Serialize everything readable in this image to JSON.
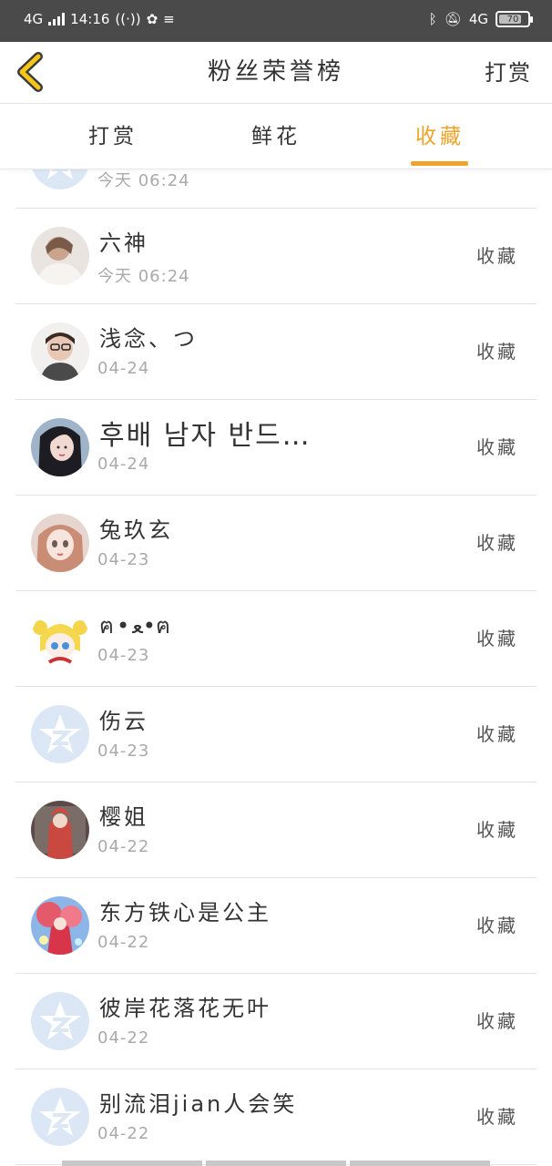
{
  "status_bar": {
    "network_left": "4G",
    "time": "14:16",
    "network_right": "4G",
    "battery": "70"
  },
  "header": {
    "title": "粉丝荣誉榜",
    "action": "打赏"
  },
  "tabs": [
    {
      "label": "打赏",
      "active": false
    },
    {
      "label": "鲜花",
      "active": false
    },
    {
      "label": "收藏",
      "active": true
    }
  ],
  "accent_color": "#f0a32a",
  "list": [
    {
      "name": "",
      "date": "今天 06:24",
      "action": "",
      "avatar": "default-star"
    },
    {
      "name": "六神",
      "date": "今天 06:24",
      "action": "收藏",
      "avatar": "photo-girl-white"
    },
    {
      "name": "浅念、つ",
      "date": "04-24",
      "action": "收藏",
      "avatar": "photo-boy-glasses"
    },
    {
      "name": "후배 남자 반드…",
      "date": "04-24",
      "action": "收藏",
      "avatar": "photo-girl-dark"
    },
    {
      "name": "兔玖玄",
      "date": "04-23",
      "action": "收藏",
      "avatar": "doll-face"
    },
    {
      "name": "ฅ•ﻌ•ฅ",
      "date": "04-23",
      "action": "收藏",
      "avatar": "anime-sailor"
    },
    {
      "name": "伤云",
      "date": "04-23",
      "action": "收藏",
      "avatar": "default-star"
    },
    {
      "name": "樱姐",
      "date": "04-22",
      "action": "收藏",
      "avatar": "anime-red"
    },
    {
      "name": "东方铁心是公主",
      "date": "04-22",
      "action": "收藏",
      "avatar": "anime-colorful"
    },
    {
      "name": "彼岸花落花无叶",
      "date": "04-22",
      "action": "收藏",
      "avatar": "default-star"
    },
    {
      "name": "别流泪jian人会笑",
      "date": "04-22",
      "action": "收藏",
      "avatar": "default-star"
    }
  ]
}
